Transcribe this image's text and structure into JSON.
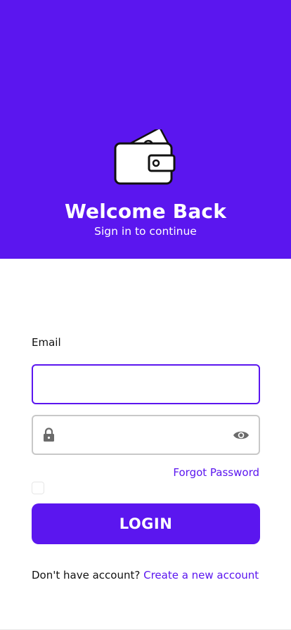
{
  "header": {
    "title": "Welcome Back",
    "subtitle": "Sign in to continue",
    "logo_icon": "wallet-icon",
    "background_color": "#5b16ef"
  },
  "form": {
    "email_label": "Email",
    "email_value": "",
    "password_value": "",
    "password_left_icon": "lock-icon",
    "password_right_icon": "eye-icon",
    "forgot_password": "Forgot Password",
    "remember_me_checked": false,
    "login_button": "LOGIN"
  },
  "footer": {
    "prompt": "Don't have account?",
    "create_account_link": "Create a new account"
  },
  "colors": {
    "accent": "#5b16ef",
    "field_border_inactive": "#c8c8c8"
  }
}
